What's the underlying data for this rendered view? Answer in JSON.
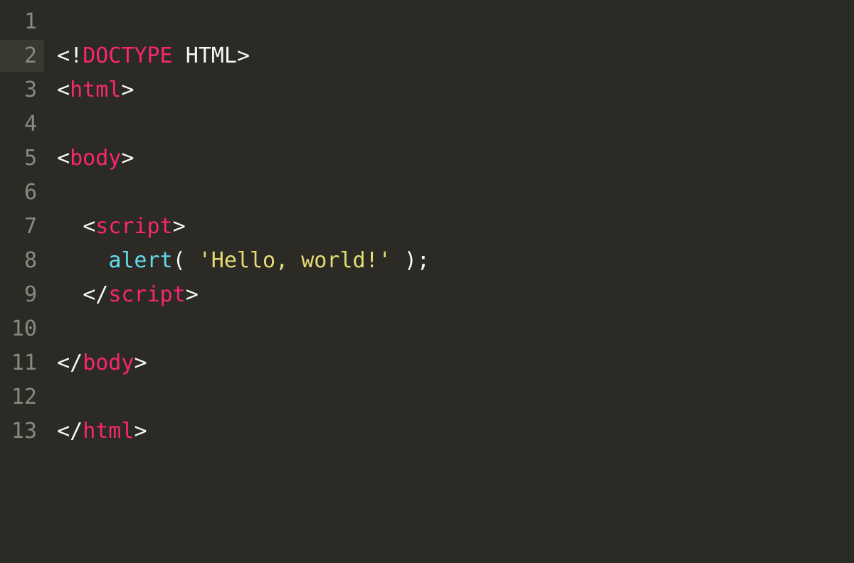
{
  "editor": {
    "language": "html",
    "active_line": 2,
    "lines": [
      {
        "num": 1,
        "tokens": []
      },
      {
        "num": 2,
        "tokens": [
          {
            "cls": "punct",
            "text": "<!"
          },
          {
            "cls": "keyword",
            "text": "DOCTYPE "
          },
          {
            "cls": "plain",
            "text": "HTML"
          },
          {
            "cls": "punct",
            "text": ">"
          }
        ]
      },
      {
        "num": 3,
        "tokens": [
          {
            "cls": "punct",
            "text": "<"
          },
          {
            "cls": "keyword",
            "text": "html"
          },
          {
            "cls": "punct",
            "text": ">"
          }
        ]
      },
      {
        "num": 4,
        "tokens": []
      },
      {
        "num": 5,
        "tokens": [
          {
            "cls": "punct",
            "text": "<"
          },
          {
            "cls": "keyword",
            "text": "body"
          },
          {
            "cls": "punct",
            "text": ">"
          }
        ]
      },
      {
        "num": 6,
        "tokens": []
      },
      {
        "num": 7,
        "tokens": [
          {
            "cls": "plain",
            "text": "  "
          },
          {
            "cls": "punct",
            "text": "<"
          },
          {
            "cls": "keyword",
            "text": "script"
          },
          {
            "cls": "punct",
            "text": ">"
          }
        ]
      },
      {
        "num": 8,
        "tokens": [
          {
            "cls": "plain",
            "text": "    "
          },
          {
            "cls": "func",
            "text": "alert"
          },
          {
            "cls": "plain",
            "text": "( "
          },
          {
            "cls": "string",
            "text": "'Hello, world!'"
          },
          {
            "cls": "plain",
            "text": " );"
          }
        ]
      },
      {
        "num": 9,
        "tokens": [
          {
            "cls": "plain",
            "text": "  "
          },
          {
            "cls": "punct",
            "text": "</"
          },
          {
            "cls": "keyword",
            "text": "script"
          },
          {
            "cls": "punct",
            "text": ">"
          }
        ]
      },
      {
        "num": 10,
        "tokens": []
      },
      {
        "num": 11,
        "tokens": [
          {
            "cls": "punct",
            "text": "</"
          },
          {
            "cls": "keyword",
            "text": "body"
          },
          {
            "cls": "punct",
            "text": ">"
          }
        ]
      },
      {
        "num": 12,
        "tokens": []
      },
      {
        "num": 13,
        "tokens": [
          {
            "cls": "punct",
            "text": "</"
          },
          {
            "cls": "keyword",
            "text": "html"
          },
          {
            "cls": "punct",
            "text": ">"
          }
        ]
      }
    ]
  }
}
